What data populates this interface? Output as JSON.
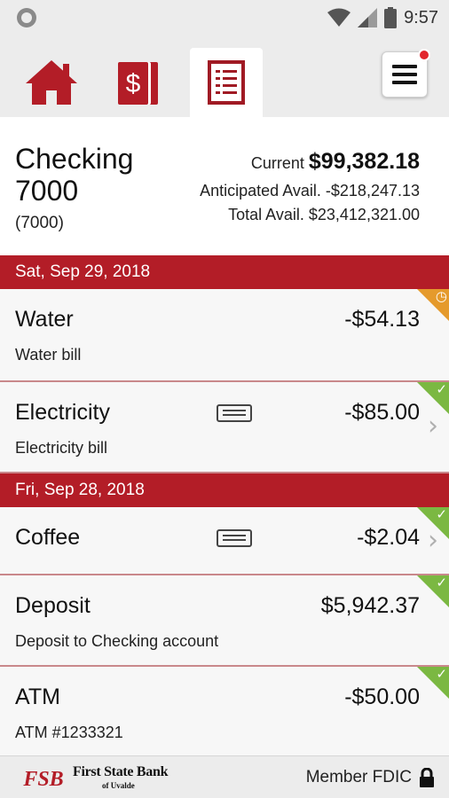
{
  "status_bar": {
    "time": "9:57"
  },
  "nav": {
    "tabs": [
      {
        "name": "home",
        "icon": "home-icon"
      },
      {
        "name": "transfers",
        "icon": "money-icon"
      },
      {
        "name": "transactions",
        "icon": "document-list-icon",
        "active": true
      }
    ],
    "menu_icon": "hamburger-icon",
    "accent": "#b31d27"
  },
  "account": {
    "name": "Checking 7000",
    "number": "(7000)",
    "current_label": "Current",
    "current_amount": "$99,382.18",
    "anticipated_label": "Anticipated Avail.",
    "anticipated_amount": "-$218,247.13",
    "total_label": "Total Avail.",
    "total_amount": "$23,412,321.00"
  },
  "groups": [
    {
      "date": "Sat, Sep 29, 2018",
      "transactions": [
        {
          "name": "Water",
          "description": "Water bill",
          "amount": "-$54.13",
          "status": "pending",
          "status_icon": "clock-icon"
        },
        {
          "name": "Electricity",
          "description": "Electricity bill",
          "amount": "-$85.00",
          "status": "cleared",
          "status_icon": "check-icon",
          "has_card": true,
          "has_chevron": true
        }
      ]
    },
    {
      "date": "Fri, Sep 28, 2018",
      "transactions": [
        {
          "name": "Coffee",
          "description": "",
          "amount": "-$2.04",
          "status": "cleared",
          "status_icon": "check-icon",
          "has_card": true,
          "has_chevron": true
        },
        {
          "name": "Deposit",
          "description": "Deposit to Checking account",
          "amount": "$5,942.37",
          "status": "cleared",
          "status_icon": "check-icon"
        },
        {
          "name": "ATM",
          "description": "ATM #1233321",
          "amount": "-$50.00",
          "status": "cleared",
          "status_icon": "check-icon"
        }
      ]
    }
  ],
  "footer": {
    "logo_text": "FSB",
    "bank_name": "First State Bank",
    "bank_sub": "of Uvalde",
    "member": "Member FDIC"
  },
  "colors": {
    "cleared": "#7bb842",
    "pending": "#e59a2c",
    "header": "#b31d27"
  }
}
